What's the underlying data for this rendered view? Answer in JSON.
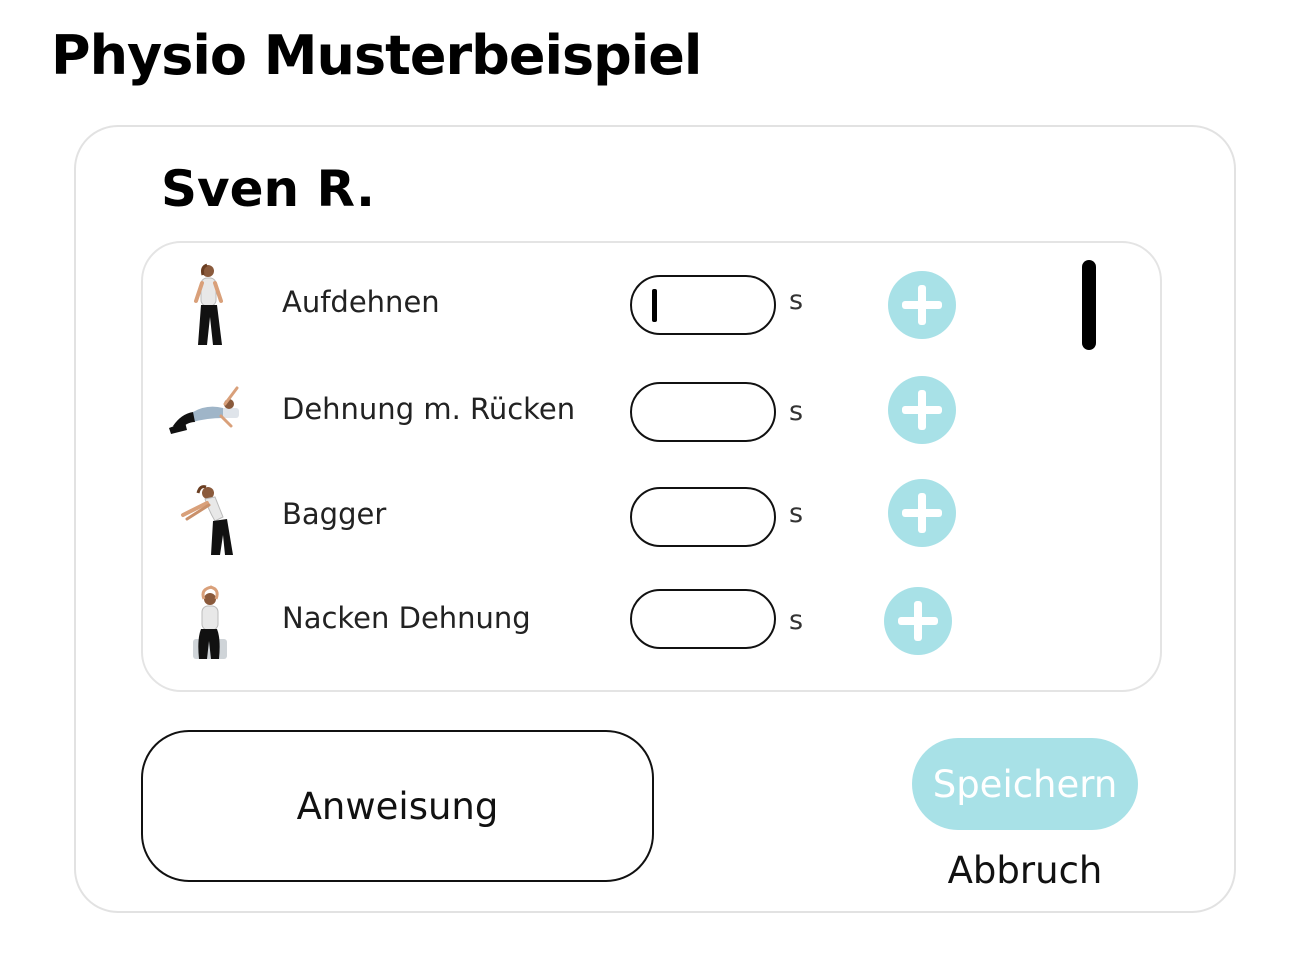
{
  "app": {
    "title": "Physio Musterbeispiel"
  },
  "patient": {
    "name": "Sven R."
  },
  "exercises": [
    {
      "name": "Aufdehnen",
      "duration_value": "",
      "unit": "s",
      "icon": "standing-stretch-figure",
      "focused": true
    },
    {
      "name": "Dehnung m. Rücken",
      "duration_value": "",
      "unit": "s",
      "icon": "lying-back-stretch-figure"
    },
    {
      "name": "Bagger",
      "duration_value": "",
      "unit": "s",
      "icon": "forward-reach-figure"
    },
    {
      "name": "Nacken Dehnung",
      "duration_value": "",
      "unit": "s",
      "icon": "seated-neck-stretch-figure"
    }
  ],
  "actions": {
    "instruction_label": "Anweisung",
    "save_label": "Speichern",
    "cancel_label": "Abbruch"
  },
  "colors": {
    "accent": "#a8e1e7",
    "border": "#e2e2e2",
    "text": "#111111"
  }
}
